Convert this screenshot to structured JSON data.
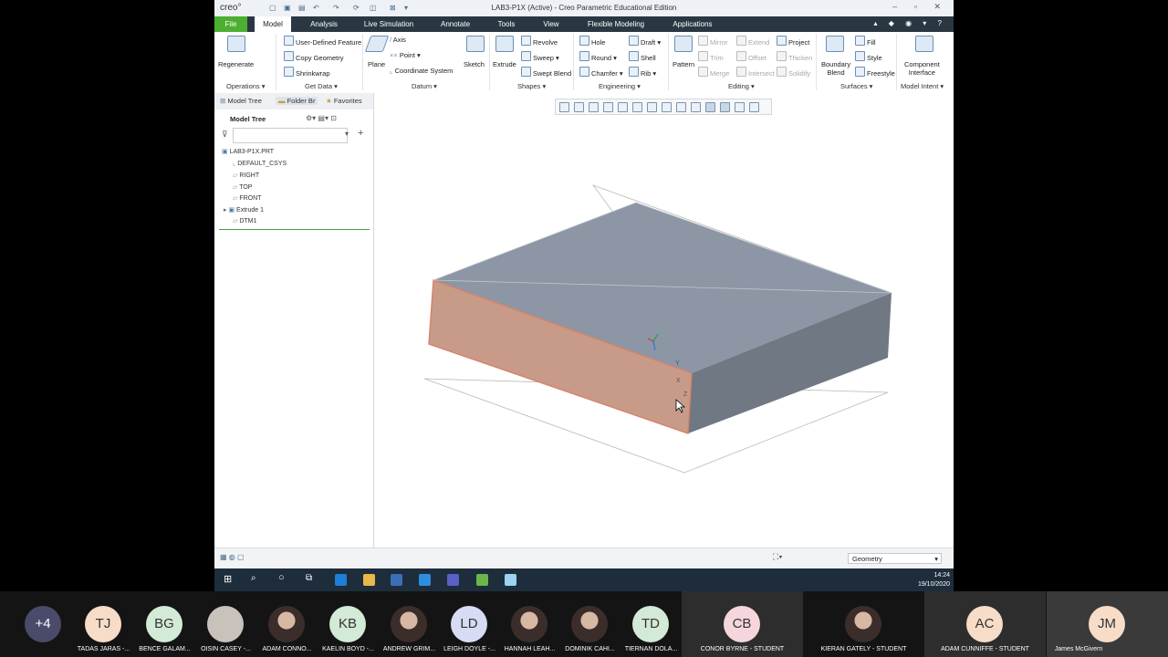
{
  "window": {
    "app_logo": "creo°",
    "title": "LAB3-P1X (Active) - Creo Parametric Educational Edition",
    "controls": [
      "–",
      "▫",
      "✕"
    ]
  },
  "ribbon_tabs": [
    "File",
    "Model",
    "Analysis",
    "Live Simulation",
    "Annotate",
    "Tools",
    "View",
    "Flexible Modeling",
    "Applications"
  ],
  "ribbon": {
    "operations": {
      "regenerate": "Regenerate",
      "group": "Operations ▾"
    },
    "get_data": {
      "udf": "User-Defined Feature",
      "copy_geometry": "Copy Geometry",
      "shrinkwrap": "Shrinkwrap",
      "group": "Get Data ▾"
    },
    "datum": {
      "plane": "Plane",
      "axis": "Axis",
      "point": "Point ▾",
      "csys": "Coordinate System",
      "sketch": "Sketch",
      "group": "Datum ▾"
    },
    "shapes": {
      "extrude": "Extrude",
      "revolve": "Revolve",
      "sweep": "Sweep ▾",
      "swept_blend": "Swept Blend",
      "group": "Shapes ▾"
    },
    "engineering": {
      "hole": "Hole",
      "round": "Round ▾",
      "chamfer": "Chamfer ▾",
      "draft": "Draft ▾",
      "shell": "Shell",
      "rib": "Rib ▾",
      "group": "Engineering ▾"
    },
    "editing": {
      "pattern": "Pattern",
      "mirror": "Mirror",
      "trim": "Trim",
      "merge": "Merge",
      "extend": "Extend",
      "offset": "Offset",
      "intersect": "Intersect",
      "project": "Project",
      "thicken": "Thicken",
      "solidify": "Solidify",
      "group": "Editing ▾"
    },
    "surfaces": {
      "boundary_blend_1": "Boundary",
      "boundary_blend_2": "Blend",
      "fill": "Fill",
      "style": "Style",
      "freestyle": "Freestyle",
      "group": "Surfaces ▾"
    },
    "model_intent": {
      "component_1": "Component",
      "component_2": "Interface",
      "group": "Model Intent ▾"
    }
  },
  "left_panel": {
    "tabs": [
      "Model Tree",
      "Folder Br",
      "Favorites"
    ],
    "title": "Model Tree",
    "filter_placeholder": "",
    "tree": [
      "LAB3-P1X.PRT",
      "DEFAULT_CSYS",
      "RIGHT",
      "TOP",
      "FRONT",
      "Extrude 1",
      "DTM1"
    ]
  },
  "viewport": {
    "axis_labels": {
      "y": "Y",
      "x": "X",
      "z": "Z"
    },
    "colors": {
      "top_face": "#8c96a4",
      "side_face": "#6f7883",
      "selected_face": "#c79b88",
      "selection_edge": "#d7826a"
    }
  },
  "status_bar": {
    "filter": "Geometry"
  },
  "taskbar": {
    "time": "14:24",
    "date": "19/10/2020"
  },
  "participants": [
    {
      "initials": "+4",
      "name": "",
      "color": "#4a4a6a"
    },
    {
      "initials": "TJ",
      "name": "TADAS JARAS -...",
      "color": "#f7dcc8"
    },
    {
      "initials": "BG",
      "name": "BENCE GALAM...",
      "color": "#d3ead6"
    },
    {
      "initials": "",
      "name": "OISIN CASEY -...",
      "color": "#c8c2ba"
    },
    {
      "initials": "",
      "name": "ADAM CONNO...",
      "color": "photo"
    },
    {
      "initials": "KB",
      "name": "KAELIN BOYD -...",
      "color": "#d3ead6"
    },
    {
      "initials": "",
      "name": "ANDREW GRIM...",
      "color": "photo"
    },
    {
      "initials": "LD",
      "name": "LEIGH DOYLE -...",
      "color": "#d5dcf4"
    },
    {
      "initials": "",
      "name": "HANNAH LEAH...",
      "color": "photo"
    },
    {
      "initials": "",
      "name": "DOMINIK CAHI...",
      "color": "photo"
    },
    {
      "initials": "TD",
      "name": "TIERNAN DOLA...",
      "color": "#d3ead6"
    },
    {
      "initials": "CB",
      "name": "CONOR BYRNE - STUDENT",
      "color": "#f5d6dc"
    },
    {
      "initials": "",
      "name": "KIERAN GATELY - STUDENT",
      "color": "photo"
    },
    {
      "initials": "AC",
      "name": "ADAM CUNNIFFE - STUDENT",
      "color": "#f7dcc8"
    },
    {
      "initials": "JM",
      "name": "James McGivern",
      "color": "#f7dcc8"
    }
  ]
}
